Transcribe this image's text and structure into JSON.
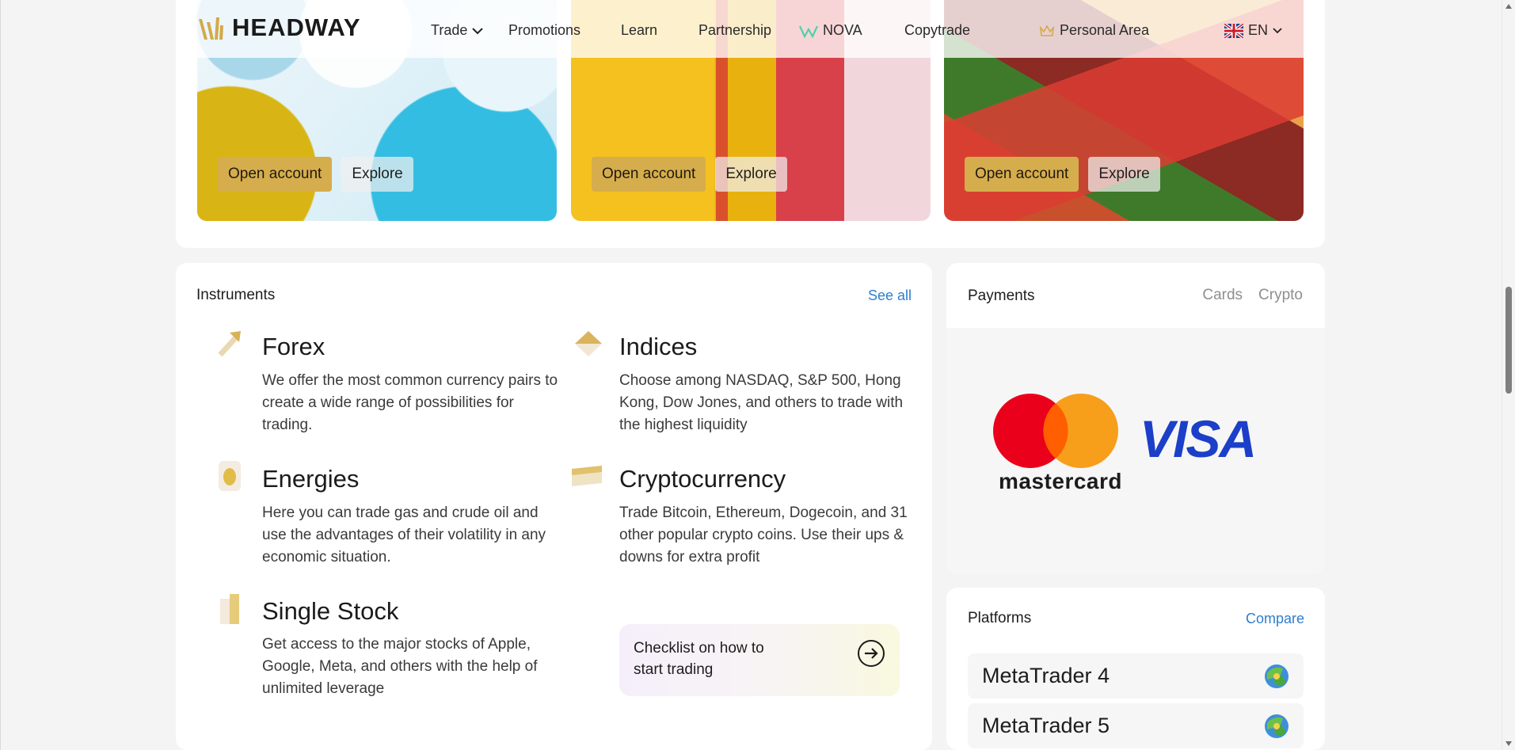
{
  "header": {
    "logo_text": "HEADWAY",
    "nav": [
      {
        "label": "Trade"
      },
      {
        "label": "Promotions"
      },
      {
        "label": "Learn"
      },
      {
        "label": "Partnership"
      },
      {
        "label": "NOVA"
      },
      {
        "label": "Copytrade"
      },
      {
        "label": "Personal Area"
      },
      {
        "label": "EN"
      }
    ]
  },
  "promos": [
    {
      "open_label": "Open account",
      "explore_label": "Explore"
    },
    {
      "open_label": "Open account",
      "explore_label": "Explore"
    },
    {
      "open_label": "Open account",
      "explore_label": "Explore"
    }
  ],
  "instruments": {
    "title": "Instruments",
    "see_all": "See all",
    "items": [
      {
        "name": "Forex",
        "desc": "We offer the most common currency pairs to create a wide range of possibilities for trading."
      },
      {
        "name": "Indices",
        "desc": "Choose among NASDAQ, S&P 500, Hong Kong, Dow Jones, and others to trade with the highest liquidity"
      },
      {
        "name": "Energies",
        "desc": "Here you can trade gas and crude oil and use the advantages of their volatility in any economic situation."
      },
      {
        "name": "Cryptocurrency",
        "desc": "Trade Bitcoin, Ethereum, Dogecoin, and 31 other popular crypto coins. Use their ups & downs for extra profit"
      },
      {
        "name": "Single Stock",
        "desc": "Get access to the major stocks of Apple, Google, Meta, and others with the help of unlimited leverage"
      }
    ],
    "checklist": "Checklist on how to start trading"
  },
  "payments": {
    "title": "Payments",
    "tabs": [
      "Cards",
      "Crypto"
    ],
    "mastercard_label": "mastercard",
    "visa_label": "VISA"
  },
  "platforms": {
    "title": "Platforms",
    "compare": "Compare",
    "items": [
      {
        "name": "MetaTrader 4"
      },
      {
        "name": "MetaTrader 5"
      }
    ]
  },
  "colors": {
    "accent_gold": "#d6ad4c",
    "link_blue": "#2d7fcf",
    "visa_blue": "#1b3fc9",
    "mc_red": "#eb001b",
    "mc_orange": "#f79e1b"
  }
}
